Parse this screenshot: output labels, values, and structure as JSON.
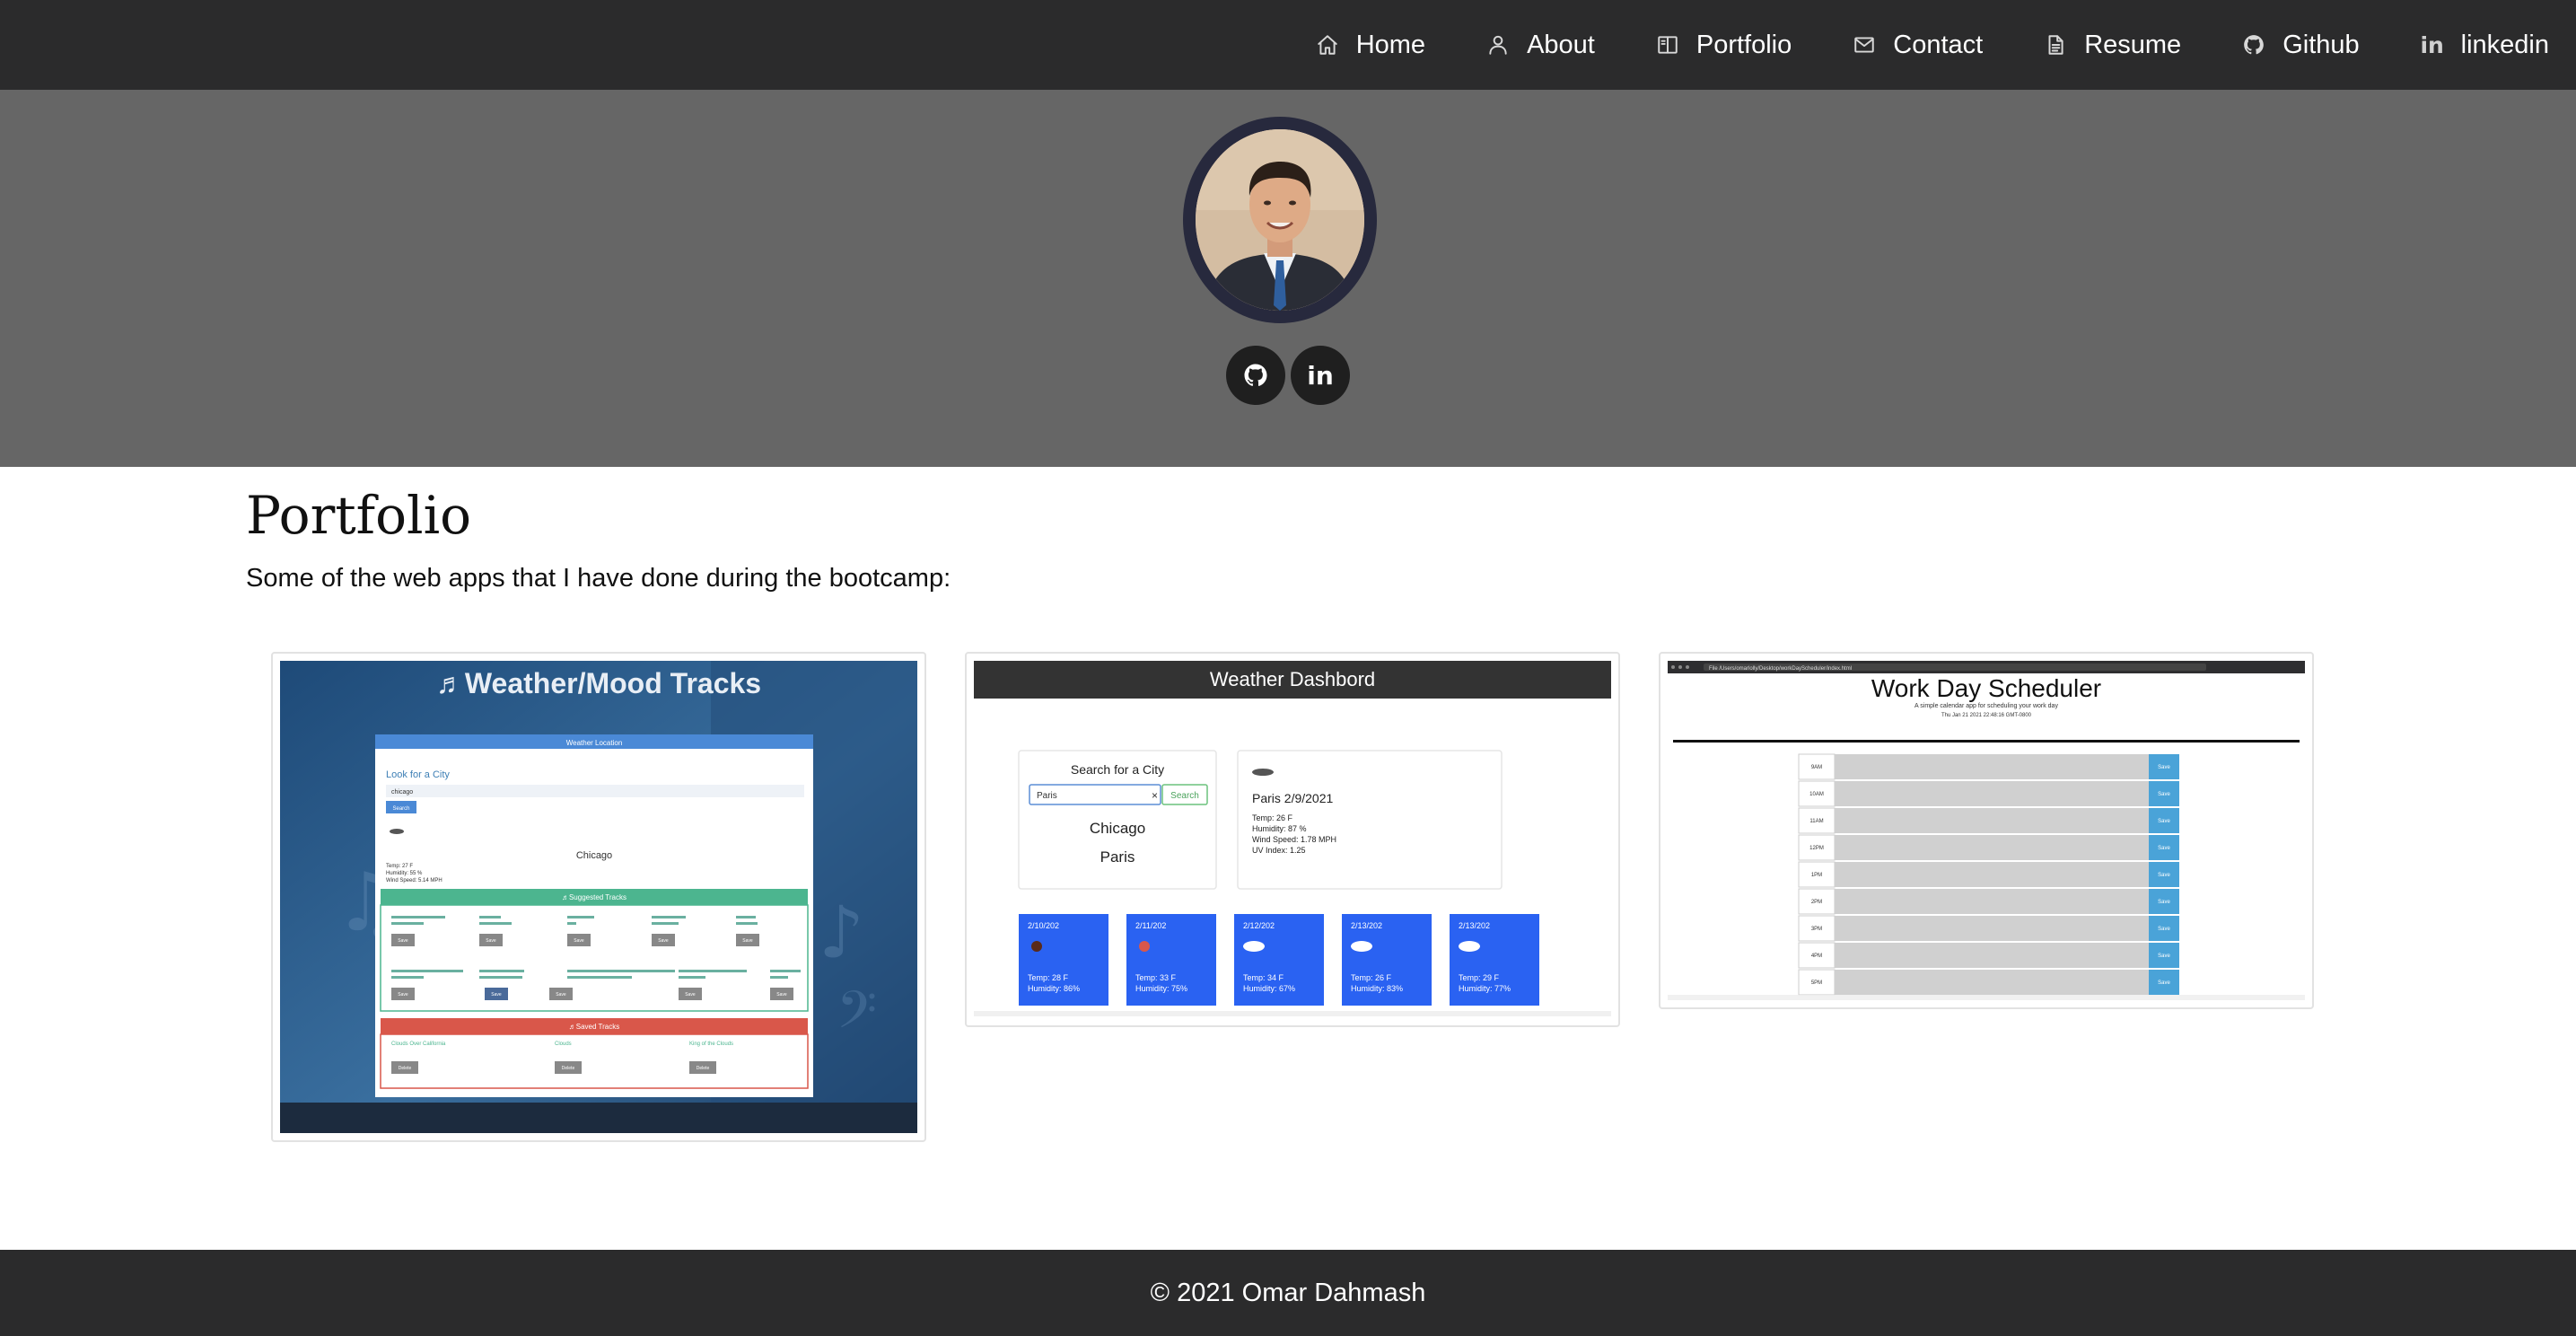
{
  "nav": {
    "items": [
      {
        "label": "Home",
        "icon": "home-icon"
      },
      {
        "label": "About",
        "icon": "person-icon"
      },
      {
        "label": "Portfolio",
        "icon": "book-icon"
      },
      {
        "label": "Contact",
        "icon": "envelope-icon"
      },
      {
        "label": "Resume",
        "icon": "document-icon"
      },
      {
        "label": "Github",
        "icon": "github-icon"
      },
      {
        "label": "linkedin",
        "icon": "linkedin-icon"
      }
    ]
  },
  "hero": {
    "social": [
      {
        "icon": "github-icon"
      },
      {
        "icon": "linkedin-icon",
        "text": "in"
      }
    ]
  },
  "portfolio": {
    "title": "Portfolio",
    "subtitle": "Some of the web apps that I have done during the bootcamp:"
  },
  "projects": [
    {
      "title": "Weather/Mood Tracks",
      "panel": {
        "header": "Weather Location",
        "prompt": "Look for a City",
        "input_value": "chicago",
        "button": "Search",
        "city": "Chicago",
        "stats": [
          "Temp: 27 F",
          "Humidity: 55 %",
          "Wind Speed: 5.14 MPH"
        ],
        "suggested_header": "♬Suggested Tracks",
        "saved_header": "♬Saved Tracks",
        "save_label": "Save",
        "delete_label": "Delete",
        "saved_tracks": [
          "Clouds Over California",
          "Clouds",
          "King of the Clouds"
        ]
      }
    },
    {
      "title": "Weather Dashbord",
      "search_label": "Search for a City",
      "input_value": "Paris",
      "clear_symbol": "×",
      "search_button": "Search",
      "history": [
        "Chicago",
        "Paris"
      ],
      "current": {
        "heading": "Paris 2/9/2021",
        "lines": [
          "Temp: 26 F",
          "Humidity: 87 %",
          "Wind Speed: 1.78 MPH",
          "UV Index: 1.25"
        ]
      },
      "forecast": [
        {
          "date": "2/10/202",
          "temp": "Temp: 28 F",
          "humidity": "Humidity: 86%"
        },
        {
          "date": "2/11/202",
          "temp": "Temp: 33 F",
          "humidity": "Humidity: 75%"
        },
        {
          "date": "2/12/202",
          "temp": "Temp: 34 F",
          "humidity": "Humidity: 67%"
        },
        {
          "date": "2/13/202",
          "temp": "Temp: 26 F",
          "humidity": "Humidity: 83%"
        },
        {
          "date": "2/13/202",
          "temp": "Temp: 29 F",
          "humidity": "Humidity: 77%"
        }
      ],
      "accent": "#2a62f2",
      "header_color": "#333333"
    },
    {
      "title": "Work Day Scheduler",
      "tagline": "A simple calendar app for scheduling your work day",
      "date_line": "Thu Jan 21 2021 22:48:16 GMT-0800",
      "url": "File  /Users/omarlolly/Desktop/workDayScheduler/index.html",
      "hours": [
        "9AM",
        "10AM",
        "11AM",
        "12PM",
        "1PM",
        "2PM",
        "3PM",
        "4PM",
        "5PM"
      ],
      "save_label": "Save",
      "accent": "#4aa3d8"
    }
  ],
  "footer": {
    "text": "© 2021 Omar Dahmash"
  }
}
